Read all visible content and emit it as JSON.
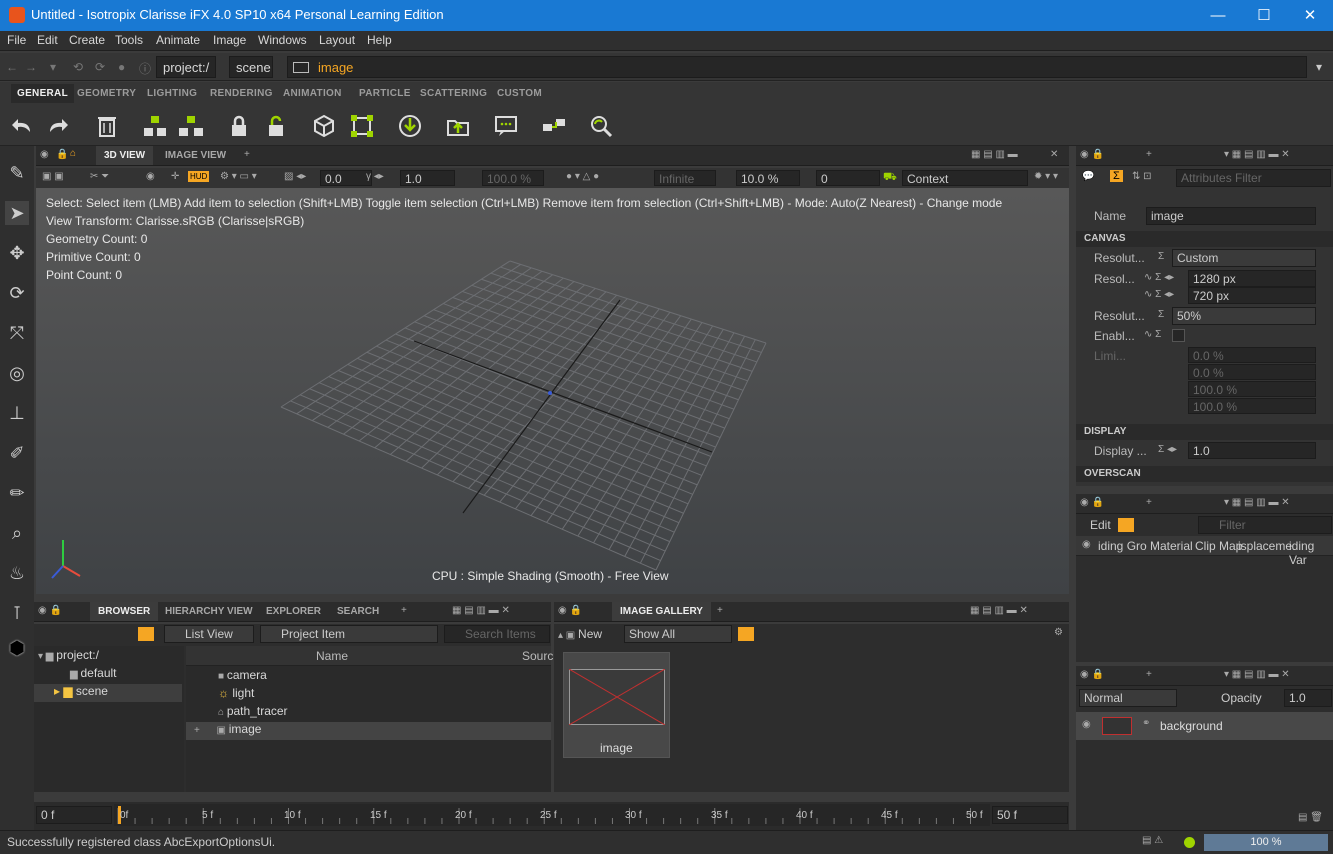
{
  "window": {
    "title": "Untitled - Isotropix Clarisse iFX 4.0 SP10 x64 Personal Learning Edition",
    "min": "—",
    "max": "☐",
    "close": "✕"
  },
  "menu": [
    "File",
    "Edit",
    "Create",
    "Tools",
    "Animate",
    "Image",
    "Windows",
    "Layout",
    "Help"
  ],
  "address": {
    "project": "project:/",
    "scene": "scene",
    "item": "image"
  },
  "shelf_tabs": [
    "GENERAL",
    "GEOMETRY",
    "LIGHTING",
    "RENDERING",
    "ANIMATION",
    "PARTICLE",
    "SCATTERING",
    "CUSTOM"
  ],
  "viewport": {
    "tabs": [
      "3D VIEW",
      "IMAGE VIEW"
    ],
    "fields": {
      "v1": "0.0",
      "v2": "1.0",
      "v3": "100.0 %",
      "v4": "Infinite",
      "v5": "10.0 %",
      "v6": "0",
      "context": "Context"
    },
    "info": [
      "Select: Select item (LMB)  Add item to selection (Shift+LMB)  Toggle item selection (Ctrl+LMB)  Remove item from selection (Ctrl+Shift+LMB)  - Mode: Auto(Z Nearest) - Change mode",
      "View Transform: Clarisse.sRGB (Clarisse|sRGB)",
      "Geometry Count: 0",
      "Primitive Count: 0",
      "Point Count: 0"
    ],
    "footer": "CPU : Simple Shading (Smooth) - Free View"
  },
  "attributes": {
    "filter_placeholder": "Attributes Filter",
    "name_label": "Name",
    "name_value": "image",
    "canvas": "CANVAS",
    "res_preset_label": "Resolut...",
    "res_preset": "Custom",
    "res_label": "Resol...",
    "res_w": "1280 px",
    "res_h": "720 px",
    "res_mult_label": "Resolut...",
    "res_mult": "50%",
    "enable_label": "Enabl...",
    "limit_label": "Limi...",
    "lim1": "0.0 %",
    "lim2": "0.0 %",
    "lim3": "100.0 %",
    "lim4": "100.0 %",
    "display": "DISPLAY",
    "display_label": "Display ...",
    "display_value": "1.0",
    "overscan": "OVERSCAN"
  },
  "material_panel": {
    "edit": "Edit",
    "filter_placeholder": "Filter",
    "columns": [
      "iding Gro",
      "Material",
      "Clip Map",
      "isplaceme",
      "iding Var"
    ]
  },
  "browser": {
    "tabs": [
      "BROWSER",
      "HIERARCHY VIEW",
      "EXPLORER",
      "SEARCH"
    ],
    "list_view": "List View",
    "project_item": "Project Item",
    "search_placeholder": "Search Items",
    "tree": [
      "project:/",
      "default",
      "scene"
    ],
    "col_name": "Name",
    "col_source": "Sourc",
    "items": [
      "camera",
      "light",
      "path_tracer",
      "image"
    ]
  },
  "gallery": {
    "tab": "IMAGE GALLERY",
    "new": "New",
    "show": "Show All",
    "thumb_label": "image"
  },
  "layers": {
    "blend": "Normal",
    "opacity_label": "Opacity",
    "opacity": "1.0",
    "layer": "background"
  },
  "timeline": {
    "start": "0 f",
    "end": "50 f",
    "ticks": [
      "0f",
      "5 f",
      "10 f",
      "15 f",
      "20 f",
      "25 f",
      "30 f",
      "35 f",
      "40 f",
      "45 f",
      "50 f"
    ]
  },
  "status": {
    "message": "Successfully registered class AbcExportOptionsUi.",
    "zoom": "100 %"
  },
  "colors": {
    "titlebar": "#1979d3",
    "accent": "#f5a623",
    "green": "#9fd400"
  }
}
